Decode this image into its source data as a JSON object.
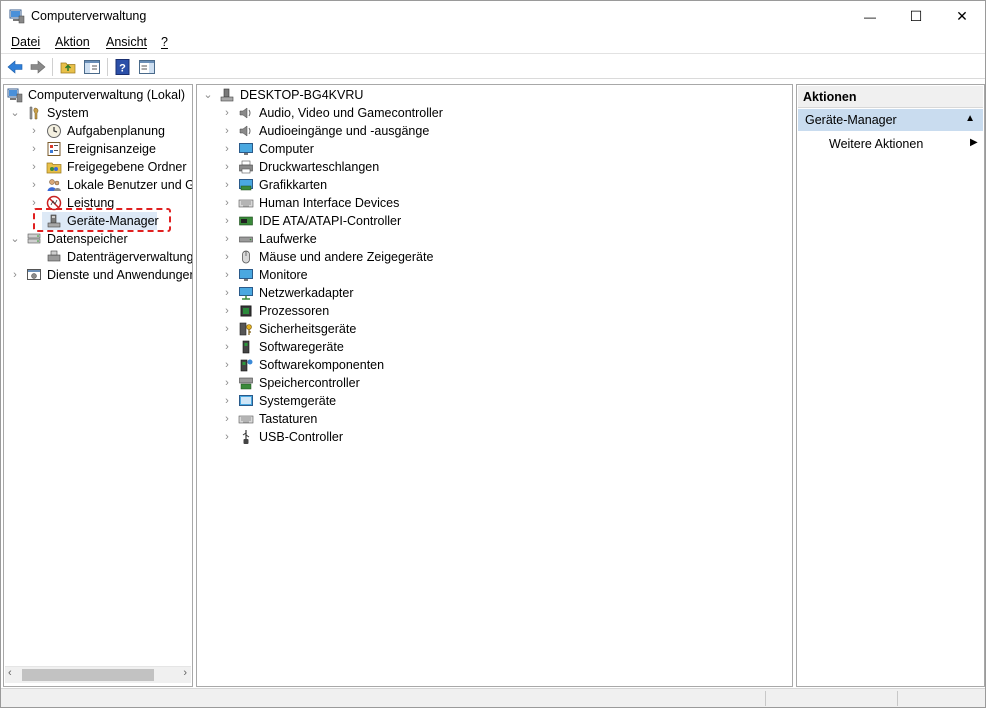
{
  "window": {
    "title": "Computerverwaltung",
    "controls": {
      "minimize": "—",
      "maximize": "☐",
      "close": "✕"
    }
  },
  "menubar": [
    "Datei",
    "Aktion",
    "Ansicht",
    "?"
  ],
  "toolbar": {
    "icons": [
      "back-arrow-icon",
      "forward-arrow-icon",
      "up-folder-icon",
      "show-hide-tree-icon",
      "help-icon",
      "show-hide-action-pane-icon"
    ]
  },
  "tree": {
    "root": "Computerverwaltung (Lokal)",
    "items": [
      {
        "label": "System",
        "level": 1,
        "expanded": true,
        "icon": "tools-icon"
      },
      {
        "label": "Aufgabenplanung",
        "level": 2,
        "icon": "clock-icon"
      },
      {
        "label": "Ereignisanzeige",
        "level": 2,
        "icon": "event-viewer-icon"
      },
      {
        "label": "Freigegebene Ordner",
        "level": 2,
        "icon": "shared-folder-icon"
      },
      {
        "label": "Lokale Benutzer und Gruppen",
        "level": 2,
        "icon": "users-icon"
      },
      {
        "label": "Leistung",
        "level": 2,
        "icon": "performance-icon"
      },
      {
        "label": "Geräte-Manager",
        "level": 2,
        "icon": "device-manager-icon",
        "selected": true
      },
      {
        "label": "Datenspeicher",
        "level": 1,
        "expanded": true,
        "icon": "storage-icon"
      },
      {
        "label": "Datenträgerverwaltung",
        "level": 2,
        "icon": "disk-management-icon"
      },
      {
        "label": "Dienste und Anwendungen",
        "level": 1,
        "icon": "services-icon"
      }
    ]
  },
  "devices": {
    "computer_name": "DESKTOP-BG4KVRU",
    "categories": [
      {
        "label": "Audio, Video und Gamecontroller",
        "icon": "speaker-icon"
      },
      {
        "label": "Audioeingänge und -ausgänge",
        "icon": "speaker-icon"
      },
      {
        "label": "Computer",
        "icon": "monitor-icon"
      },
      {
        "label": "Druckwarteschlangen",
        "icon": "printer-icon"
      },
      {
        "label": "Grafikkarten",
        "icon": "display-adapter-icon"
      },
      {
        "label": "Human Interface Devices",
        "icon": "keyboard-icon"
      },
      {
        "label": "IDE ATA/ATAPI-Controller",
        "icon": "ide-controller-icon"
      },
      {
        "label": "Laufwerke",
        "icon": "drive-icon"
      },
      {
        "label": "Mäuse und andere Zeigegeräte",
        "icon": "mouse-icon"
      },
      {
        "label": "Monitore",
        "icon": "monitor-icon"
      },
      {
        "label": "Netzwerkadapter",
        "icon": "network-icon"
      },
      {
        "label": "Prozessoren",
        "icon": "processor-icon"
      },
      {
        "label": "Sicherheitsgeräte",
        "icon": "security-key-icon"
      },
      {
        "label": "Softwaregeräte",
        "icon": "software-device-icon"
      },
      {
        "label": "Softwarekomponenten",
        "icon": "software-component-icon"
      },
      {
        "label": "Speichercontroller",
        "icon": "storage-controller-icon"
      },
      {
        "label": "Systemgeräte",
        "icon": "system-device-icon"
      },
      {
        "label": "Tastaturen",
        "icon": "keyboard-icon"
      },
      {
        "label": "USB-Controller",
        "icon": "usb-icon"
      }
    ]
  },
  "actions": {
    "header": "Aktionen",
    "section": "Geräte-Manager",
    "items": [
      "Weitere Aktionen"
    ]
  },
  "colors": {
    "accent_highlight": "#e02020",
    "action_section_bg": "#c9dcef"
  }
}
